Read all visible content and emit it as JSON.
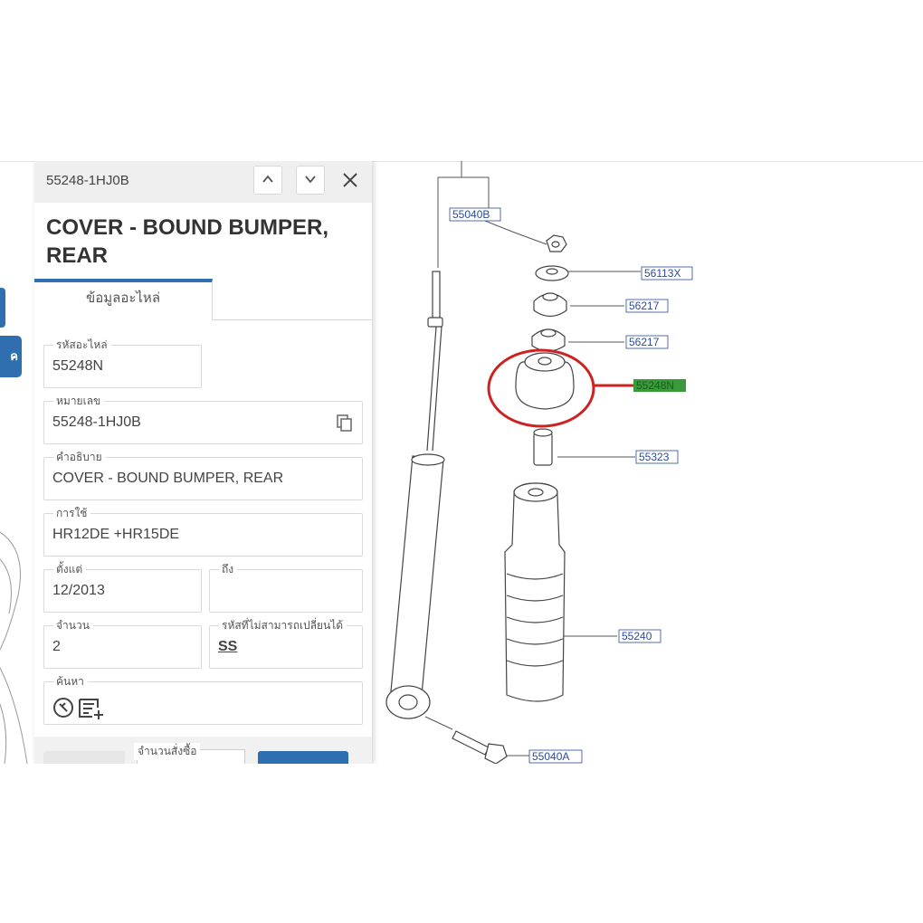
{
  "panel": {
    "header_code": "55248-1HJ0B",
    "title": "COVER - BOUND BUMPER, REAR",
    "tab_label": "ข้อมูลอะไหล่",
    "fields": {
      "part_code": {
        "label": "รหัสอะไหล่",
        "value": "55248N"
      },
      "part_number": {
        "label": "หมายเลข",
        "value": "55248-1HJ0B"
      },
      "description": {
        "label": "คำอธิบาย",
        "value": "COVER - BOUND BUMPER, REAR"
      },
      "usage": {
        "label": "การใช้",
        "value": "HR12DE +HR15DE"
      },
      "from": {
        "label": "ตั้งแต่",
        "value": "12/2013"
      },
      "to": {
        "label": "ถึง",
        "value": ""
      },
      "quantity": {
        "label": "จำนวน",
        "value": "2"
      },
      "non_replaceable": {
        "label": "รหัสที่ไม่สามารถเปลี่ยนได้",
        "value": "SS"
      },
      "search": {
        "label": "ค้นหา"
      }
    },
    "order_qty_label": "จำนวนสั่งซื้อ",
    "add_button_label": "..."
  },
  "diagram": {
    "callouts": [
      "55040B",
      "56113X",
      "56217",
      "56217",
      "55248N",
      "55323",
      "55240",
      "55040A"
    ],
    "highlight_color": "#3a9a3a",
    "circle_color": "#cc2222"
  },
  "colors": {
    "accent": "#2f6fb0"
  }
}
